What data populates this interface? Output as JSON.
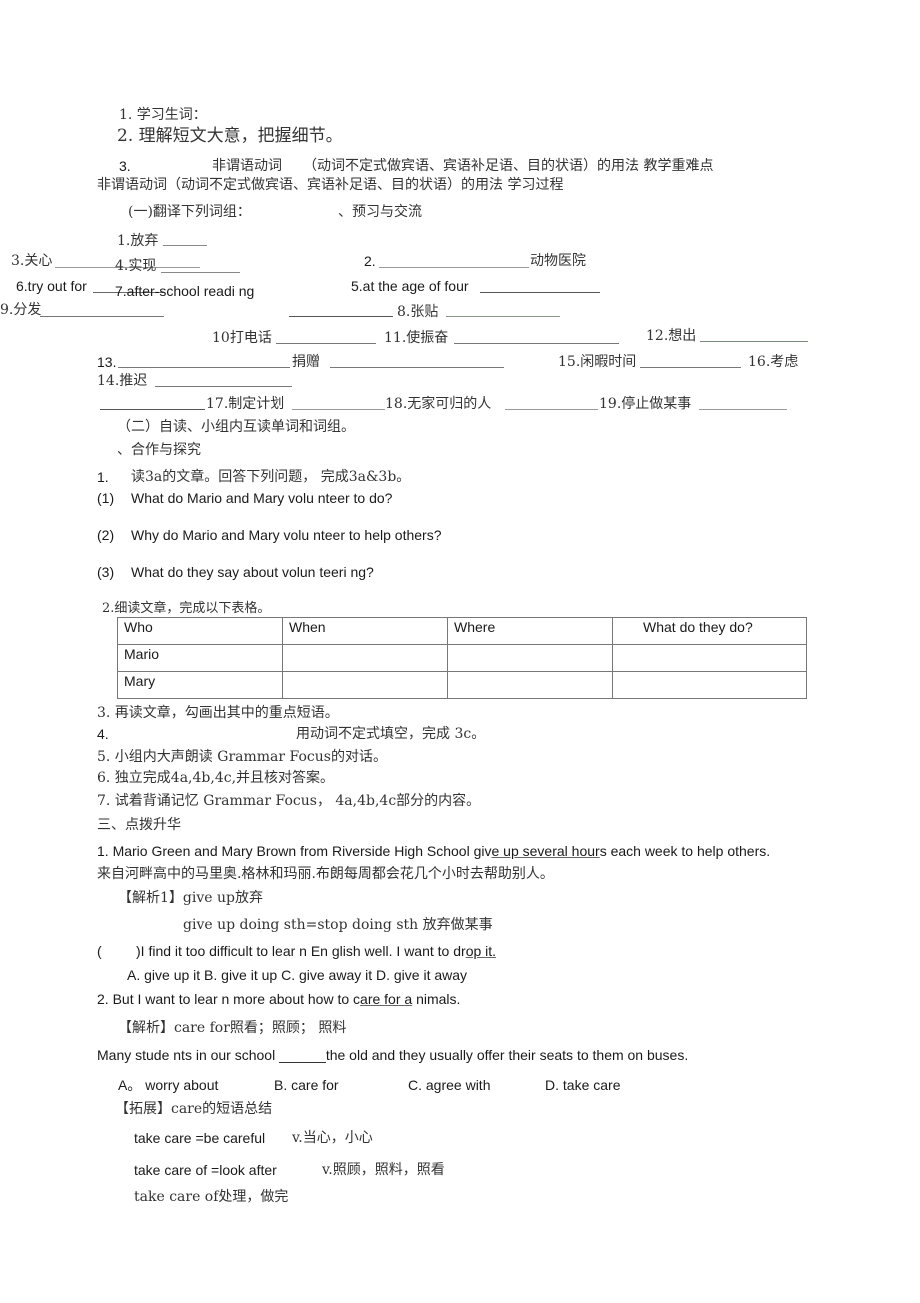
{
  "objectives": {
    "item1": "1.  学习生词：",
    "item2": "2.  理解短文大意，把握细节。",
    "item3_num": "3.",
    "item3_a": "非谓语动词",
    "item3_b": "（动词不定式做宾语、宾语补足语、目的状语）的用法  教学重难点",
    "item3_line2": "非谓语动词（动词不定式做宾语、宾语补足语、目的状语）的用法  学习过程"
  },
  "section1": {
    "heading_a": "(一)翻译下列词组：",
    "heading_b": "、预习与交流"
  },
  "phrases": {
    "p1": "1.放弃",
    "p2": "2.",
    "p2_suffix": "动物医院",
    "p3": "3.关心",
    "p4": "4.实现",
    "p5": "5.at the age of four",
    "p6": "6.try out for",
    "p7": "7.after-school readi ng",
    "p8": "8.张贴",
    "p9": "9.分发",
    "p10": "10打电话",
    "p11": "11.使振奋",
    "p12": "12.想出",
    "p13": "13.",
    "p13_suffix": "捐赠",
    "p14": "14.推迟",
    "p15": "15.闲暇时间",
    "p16": "16.考虑",
    "p17": "17.制定计划",
    "p18": "18.无家可归的人",
    "p19": "19.停止做某事"
  },
  "section2": {
    "heading": "（二）自读、小组内互读单词和词组。",
    "subheading": "、合作与探究"
  },
  "questions": {
    "q1_num": "1.",
    "q1_text": "读3a的文章。回答下列问题，  完成3a&3b。",
    "items": [
      {
        "num": "(1)",
        "text": "What do Mario and Mary volu nteer to do?"
      },
      {
        "num": "(2)",
        "text": "Why do Mario and Mary volu nteer to help others?"
      },
      {
        "num": "(3)",
        "text": "What do they say about volun teeri ng?"
      }
    ]
  },
  "table_section": {
    "title": "2.细读文章，完成以下表格。",
    "headers": [
      "Who",
      "When",
      "Where",
      "What do they do?"
    ],
    "rows": [
      [
        "Mario",
        "",
        "",
        ""
      ],
      [
        "Mary",
        "",
        "",
        ""
      ]
    ]
  },
  "tasks": {
    "t3": "3.  再读文章，勾画出其中的重点短语。",
    "t4_num": "4.",
    "t4_text": "用动词不定式填空，完成      3c。",
    "t5": "5.  小组内大声朗读  Grammar Focus的对话。",
    "t6": "6.  独立完成4a,4b,4c,并且核对答案。",
    "t7": "7.  试着背诵记忆  Grammar Focus，   4a,4b,4c部分的内容。"
  },
  "section3": {
    "heading": "三、点拨升华",
    "s1_pre": "1.  Mario Green and Mary Brown from Riverside High School giv",
    "s1_u": "e up several hour",
    "s1_post": "s each week to help others.",
    "s1_cn": "来自河畔高中的马里奥.格林和玛丽.布朗每周都会花几个小时去帮助别人。",
    "analysis1": "【解析1】give up放弃",
    "analysis1_b": "give up doing sth=stop doing sth 放弃做某事",
    "ex1_paren": "(",
    "ex1_pre": ")I find it too difficult to lear n En glish well. I want to dr",
    "ex1_u": "op it.",
    "ex1_opts": "A. give up it B. give it up C. give away it D. give it away",
    "s2_pre": "2.  But I want to lear n more about how to c",
    "s2_u": "are for a",
    "s2_post": " nimals.",
    "analysis2": "【解析】care for照看；照顾；   照料",
    "ex2_pre": "Many stude nts in our school  ",
    "ex2_blank": "______",
    "ex2_post": "the old and they usually offer their seats to them on buses.",
    "ex2_opts": [
      "A。  worry about",
      "B. care for",
      "C. agree with",
      "D. take care"
    ],
    "extension": "【拓展】care的短语总结",
    "ext_items": [
      {
        "phrase": "take care =be careful",
        "meaning": "v.当心，小心"
      },
      {
        "phrase": "take care of =look after",
        "meaning": "v.照顾，照料，照看"
      },
      {
        "phrase": "take care of处理，做完",
        "meaning": ""
      }
    ]
  }
}
